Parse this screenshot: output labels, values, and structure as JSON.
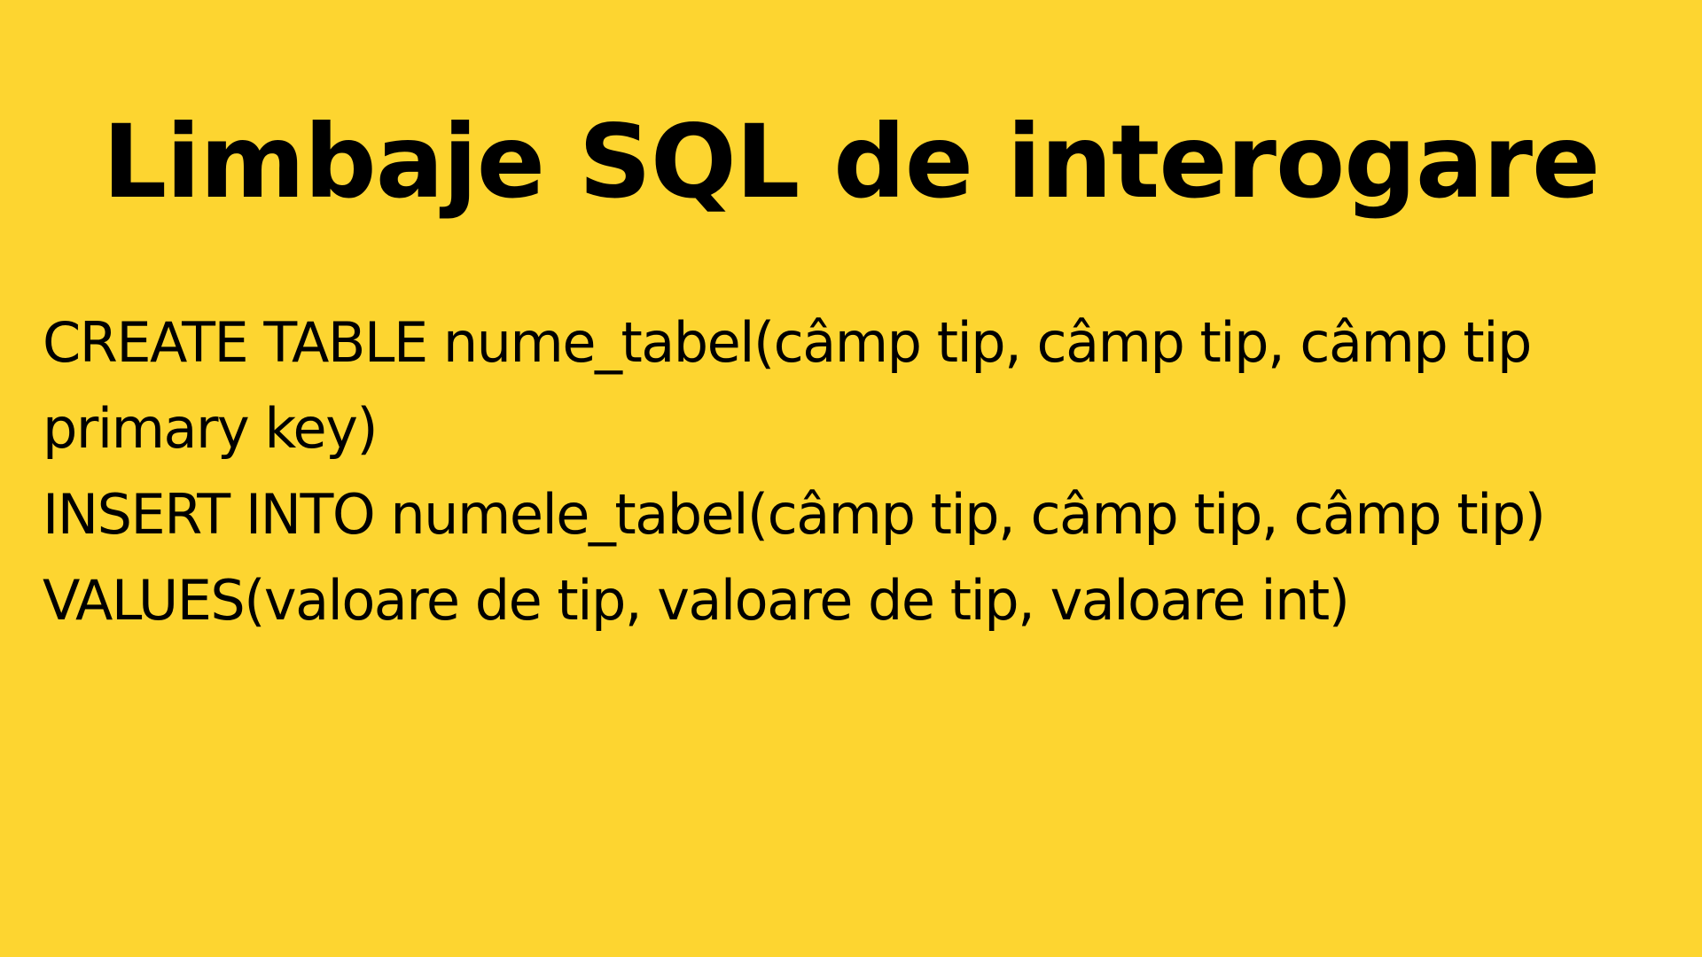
{
  "slide": {
    "title": "Limbaje SQL de interogare",
    "lines": [
      "CREATE TABLE nume_tabel(câmp tip, câmp tip, câmp tip",
      "primary key)",
      "INSERT INTO numele_tabel(câmp tip, câmp tip, câmp tip)",
      "VALUES(valoare de tip, valoare de tip, valoare int)"
    ],
    "background_color": "#FDD530",
    "text_color": "#000000"
  }
}
